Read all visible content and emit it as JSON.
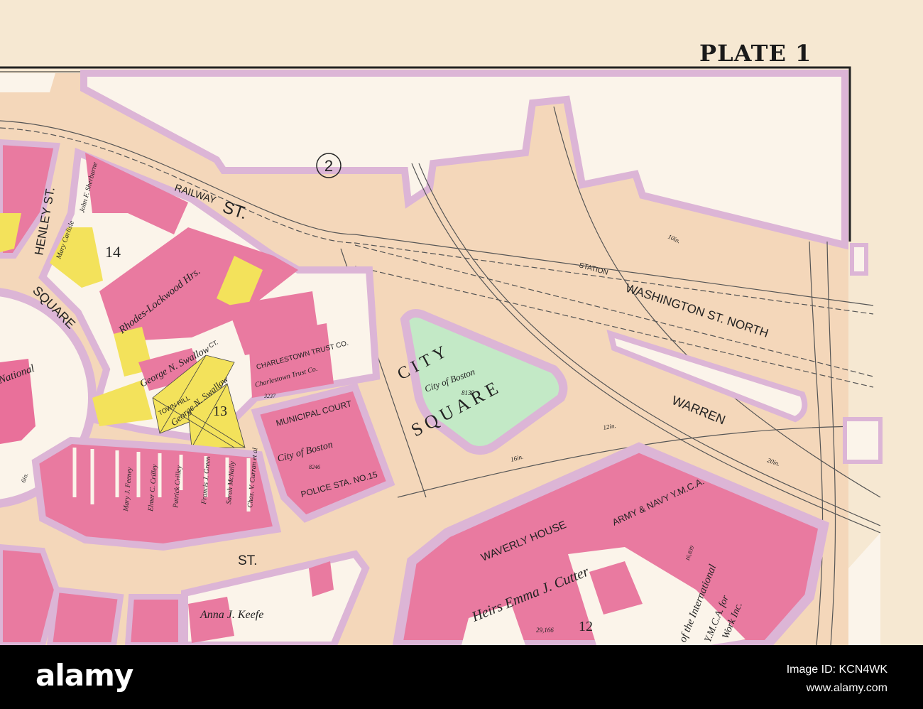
{
  "plate_label": "PLATE 1",
  "colors": {
    "paper": "#f6e8d2",
    "street": "#f4d7ba",
    "open": "#fbf4ea",
    "brick": "#e97aa0",
    "yellow": "#f3e25b",
    "park": "#c3e9c6",
    "sidewalk": "#dcb5d6"
  },
  "map": {
    "streets": [
      "RAILWAY",
      "ST.",
      "HENLEY ST.",
      "SQUARE",
      "WASHINGTON ST. NORTH",
      "WARREN",
      "ST.",
      "STATION",
      "TOWN HILL",
      "CT."
    ],
    "block_numbers": [
      "2",
      "14",
      "13",
      "12"
    ],
    "park": {
      "name1": "CITY",
      "name2": "SQUARE",
      "owner": "City of Boston",
      "area": "8139"
    },
    "buildings": [
      {
        "name": "CHARLESTOWN TRUST CO.",
        "owner": "Charlestown Trust Co.",
        "area": "3237"
      },
      {
        "name": "MUNICIPAL COURT",
        "owner": "City of Boston",
        "area": "8246"
      },
      {
        "name": "POLICE STA. NO.15"
      },
      {
        "name": "WAVERLY HOUSE",
        "owner": "Heirs Emma J. Cutter",
        "area": "29,166"
      },
      {
        "name": "ARMY & NAVY Y.M.C.A.",
        "area": "16,839"
      }
    ],
    "owners": [
      "Rhodes-Lockwood Hrs.",
      "George N. Swallow",
      "George N. Swallow",
      "Anna J. Keefe",
      "Francis J. Green",
      "Patrick Crilley",
      "Elmer C. Crilley",
      "Mary J. Feeney",
      "Sarah McNally",
      "Chas. V. Curran et al",
      "Mary Carlisle",
      "John F. Sherburne",
      "of the International",
      "Y.M.C.A. for",
      "Work Inc.",
      "National"
    ],
    "pipe_sizes": [
      "16in.",
      "12in.",
      "20in.",
      "6in.",
      "10in."
    ]
  },
  "footer": {
    "logo": "alamy",
    "image_id": "Image ID: KCN4WK",
    "url": "www.alamy.com"
  }
}
